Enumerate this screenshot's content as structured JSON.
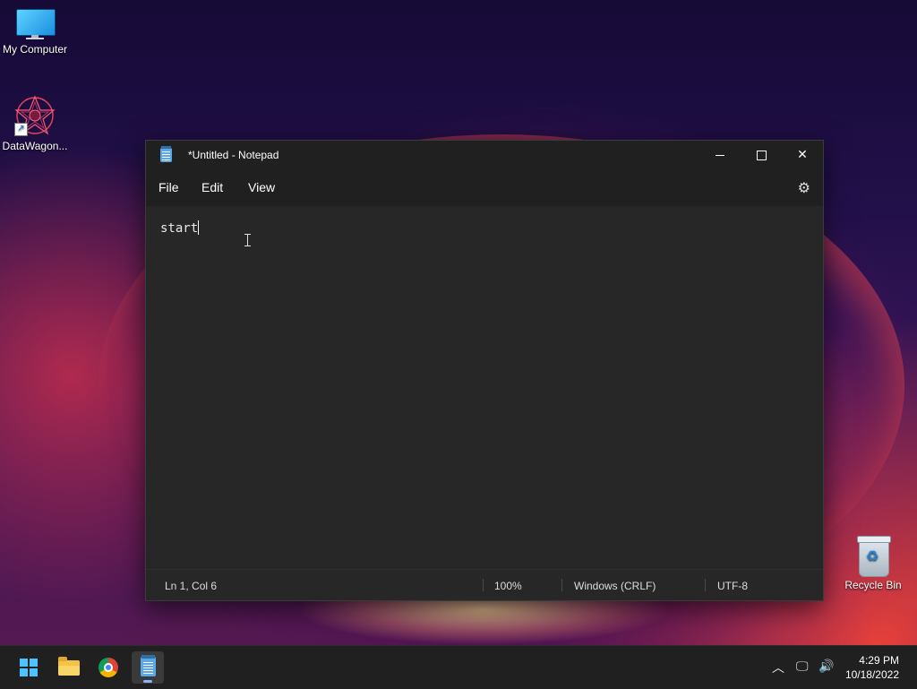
{
  "desktop": {
    "icons": [
      {
        "label": "My Computer"
      },
      {
        "label": "DataWagon..."
      },
      {
        "label": "Recycle Bin"
      }
    ]
  },
  "notepad": {
    "title": "*Untitled - Notepad",
    "menu": {
      "file": "File",
      "edit": "Edit",
      "view": "View"
    },
    "content": "start",
    "status": {
      "position": "Ln 1, Col 6",
      "zoom": "100%",
      "line_ending": "Windows (CRLF)",
      "encoding": "UTF-8"
    }
  },
  "taskbar": {
    "apps": [
      {
        "icon": "windows-start-icon"
      },
      {
        "icon": "file-explorer-icon"
      },
      {
        "icon": "chrome-icon"
      },
      {
        "icon": "notepad-icon",
        "active": true
      }
    ],
    "time": "4:29 PM",
    "date": "10/18/2022"
  },
  "colors": {
    "window_bg": "#272727",
    "titlebar_bg": "#202020",
    "taskbar_bg": "#202020",
    "accent": "#4cc2ff"
  }
}
